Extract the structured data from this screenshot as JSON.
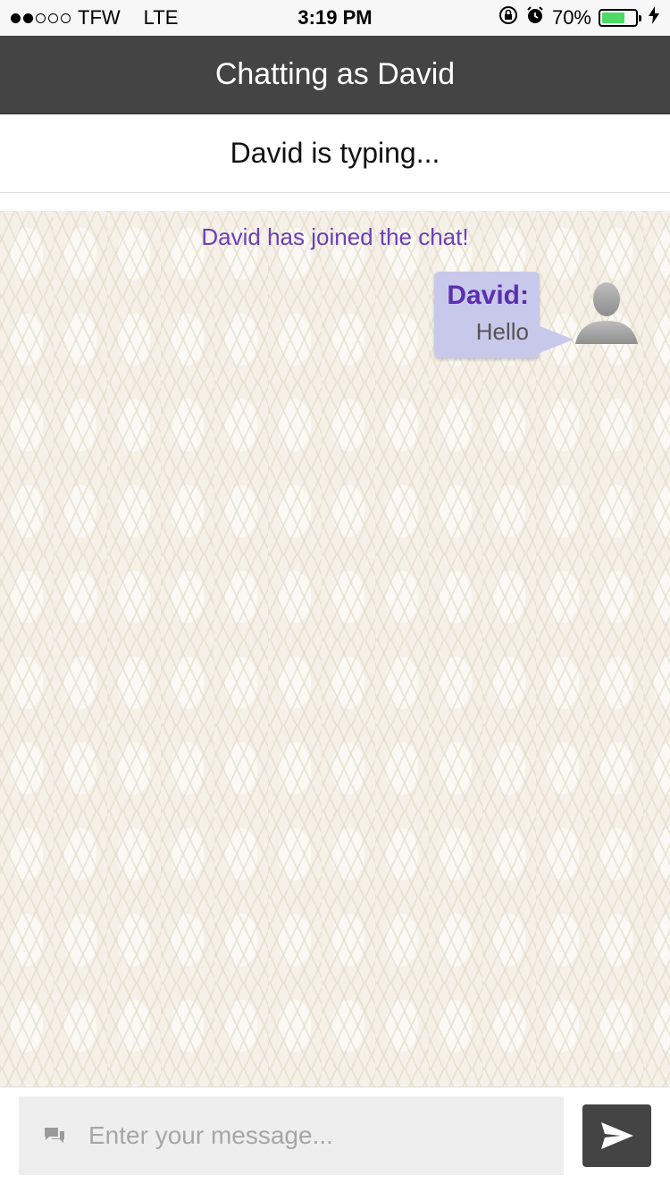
{
  "status_bar": {
    "carrier": "TFW",
    "network": "LTE",
    "time": "3:19 PM",
    "battery_percent": "70%",
    "battery_level": 0.7,
    "signal_strength": 2,
    "signal_total": 5
  },
  "header": {
    "title": "Chatting as David"
  },
  "typing_indicator": {
    "text": "David is typing..."
  },
  "chat": {
    "system_message": "David has joined the chat!",
    "messages": [
      {
        "sender": "David:",
        "text": "Hello"
      }
    ]
  },
  "composer": {
    "placeholder": "Enter your message..."
  },
  "colors": {
    "header_bg": "#444444",
    "accent_purple": "#6a3fb8",
    "bubble_bg": "#c8c9ea",
    "battery_green": "#4cd964"
  }
}
